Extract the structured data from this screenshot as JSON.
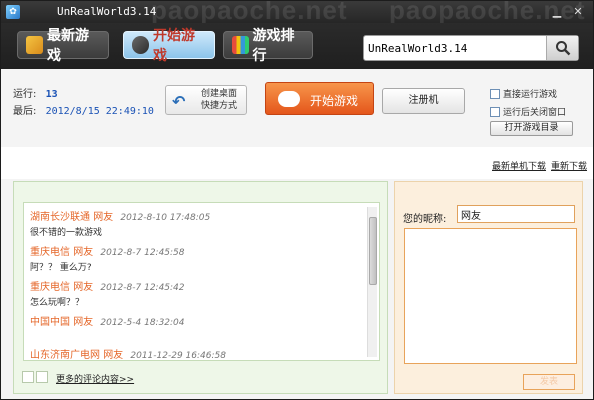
{
  "window": {
    "title": "UnRealWorld3.14",
    "watermark": "paopaoche.net",
    "minimize_glyph": "▁",
    "close_glyph": "✕"
  },
  "tabs": [
    {
      "label": "最新游戏",
      "icon": "gift-box-icon",
      "active": false
    },
    {
      "label": "开始游戏",
      "icon": "gamepad-icon",
      "active": true
    },
    {
      "label": "游戏排行",
      "icon": "bar-chart-icon",
      "active": false
    }
  ],
  "search": {
    "value": "UnRealWorld3.14",
    "icon": "magnifier-icon"
  },
  "info": {
    "run_label": "运行:",
    "run_value": "13",
    "last_label": "最后:",
    "last_value": "2012/8/15 22:49:10"
  },
  "actions": {
    "shortcut_line1": "创建桌面",
    "shortcut_line2": "快捷方式",
    "start_label": "开始游戏",
    "register_label": "注册机"
  },
  "options": {
    "direct_run": "直接运行游戏",
    "close_after": "运行后关闭窗口",
    "open_dir": "打开游戏目录"
  },
  "downloads": {
    "newest": "最新单机下载",
    "redownload": "重新下载"
  },
  "comments": [
    {
      "source": "湖南长沙联通",
      "user": "网友",
      "time": "2012-8-10 17:48:05",
      "text": "很不错的一款游戏"
    },
    {
      "source": "重庆电信",
      "user": "网友",
      "time": "2012-8-7 12:45:58",
      "text": "阿？？ 重么万?"
    },
    {
      "source": "重庆电信",
      "user": "网友",
      "time": "2012-8-7 12:45:42",
      "text": "怎么玩啊？？"
    },
    {
      "source": "中国中国",
      "user": "网友",
      "time": "2012-5-4 18:32:04",
      "text": ""
    },
    {
      "source": "山东济南广电网",
      "user": "网友",
      "time": "2011-12-29 16:46:58",
      "text": ""
    }
  ],
  "more_comments": "更多的评论内容>>",
  "form": {
    "nick_label": "您的昵称:",
    "nick_value": "网友",
    "submit_label": "发表"
  },
  "colors": {
    "accent_orange": "#e4561b",
    "link_blue": "#1a52b5",
    "comment_bg": "#eef7e8",
    "form_bg": "#fcefdd"
  }
}
